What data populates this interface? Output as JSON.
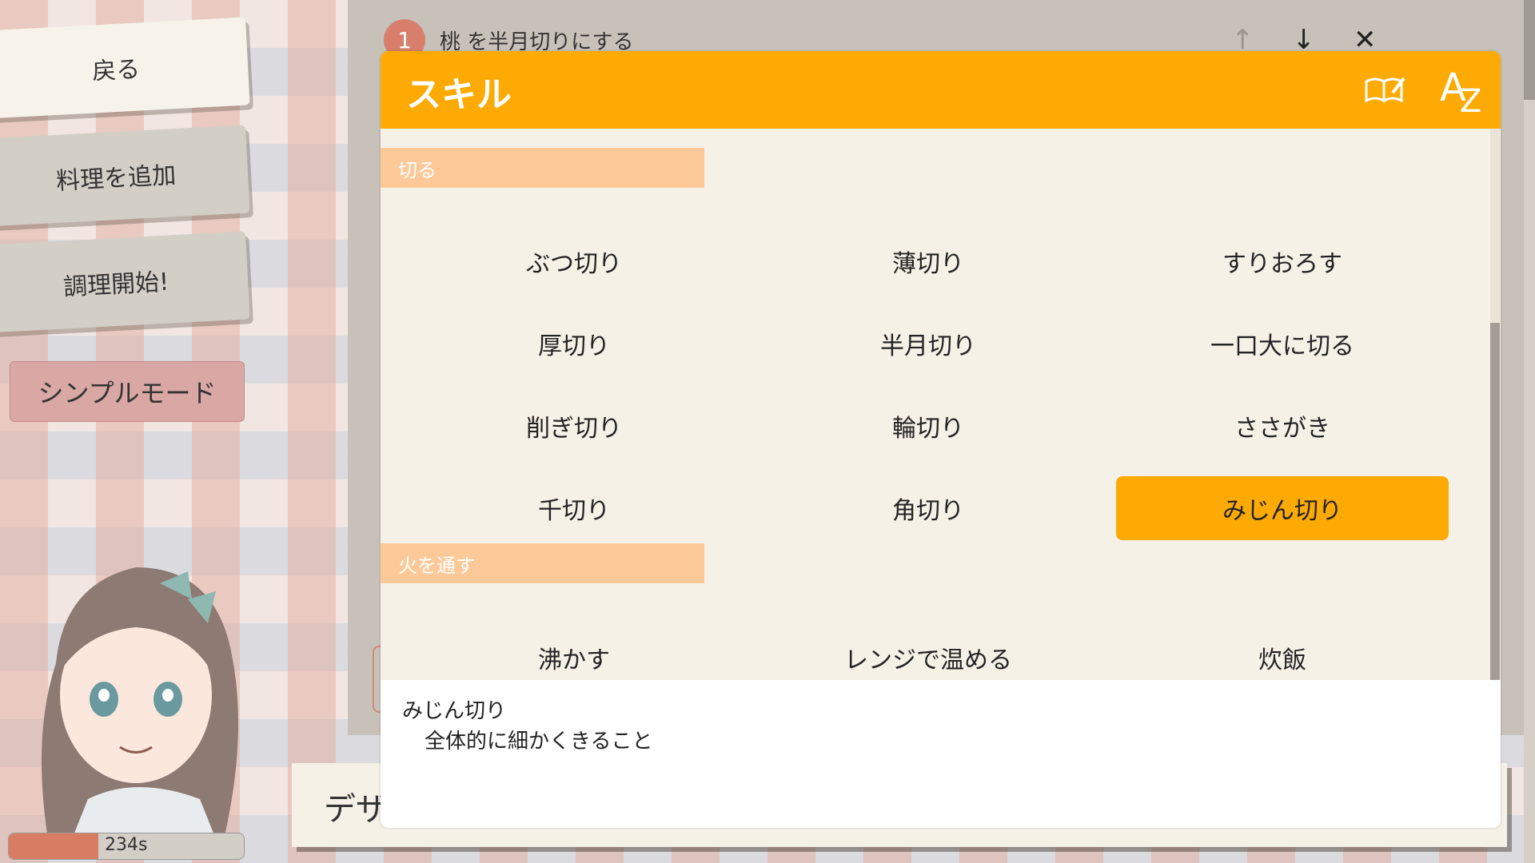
{
  "menu": {
    "back": "戻る",
    "add_dish": "料理を追加",
    "start_cooking": "調理開始!",
    "simple_mode": "シンプルモード"
  },
  "timer": {
    "label": "234s",
    "fill_fraction": 0.38
  },
  "recipe_step": {
    "number": "1",
    "text": "桃 を半月切りにする"
  },
  "step_icons": {
    "up": "↑",
    "down": "↓",
    "delete": "✕"
  },
  "back_card_text": "デザ",
  "modal": {
    "title": "スキル",
    "book_icon": "book-edit-icon",
    "sort_icon": {
      "a": "A",
      "z": "Z"
    },
    "categories": [
      {
        "label": "切る",
        "skills": [
          "ぶつ切り",
          "薄切り",
          "すりおろす",
          "厚切り",
          "半月切り",
          "一口大に切る",
          "削ぎ切り",
          "輪切り",
          "ささがき",
          "千切り",
          "角切り",
          "みじん切り"
        ]
      },
      {
        "label": "火を通す",
        "skills": [
          "沸かす",
          "レンジで温める",
          "炊飯"
        ]
      }
    ],
    "selected_skill": "みじん切り",
    "description": {
      "title": "みじん切り",
      "text": "全体的に細かくきること"
    }
  },
  "colors": {
    "accent": "#fdaa05",
    "category": "#fec998",
    "panel": "#f5f1e7"
  }
}
